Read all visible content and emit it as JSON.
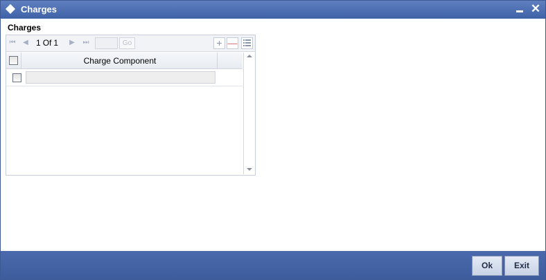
{
  "window": {
    "title": "Charges",
    "minimize_icon": "minimize-icon",
    "close_symbol": "✕"
  },
  "section": {
    "title": "Charges"
  },
  "grid": {
    "pager": {
      "current": "1",
      "of": "Of",
      "total": "1",
      "go_label": "Go",
      "page_value": ""
    },
    "toolbar": {
      "add_symbol": "+",
      "delete_symbol": "—"
    },
    "columns": [
      "Charge Component"
    ],
    "rows": [
      {
        "charge_component": ""
      }
    ]
  },
  "footer": {
    "ok_label": "Ok",
    "exit_label": "Exit"
  },
  "colors": {
    "title_bar": "#4a6aad",
    "footer": "#4a6aad",
    "button_bg": "#d3dcec"
  }
}
